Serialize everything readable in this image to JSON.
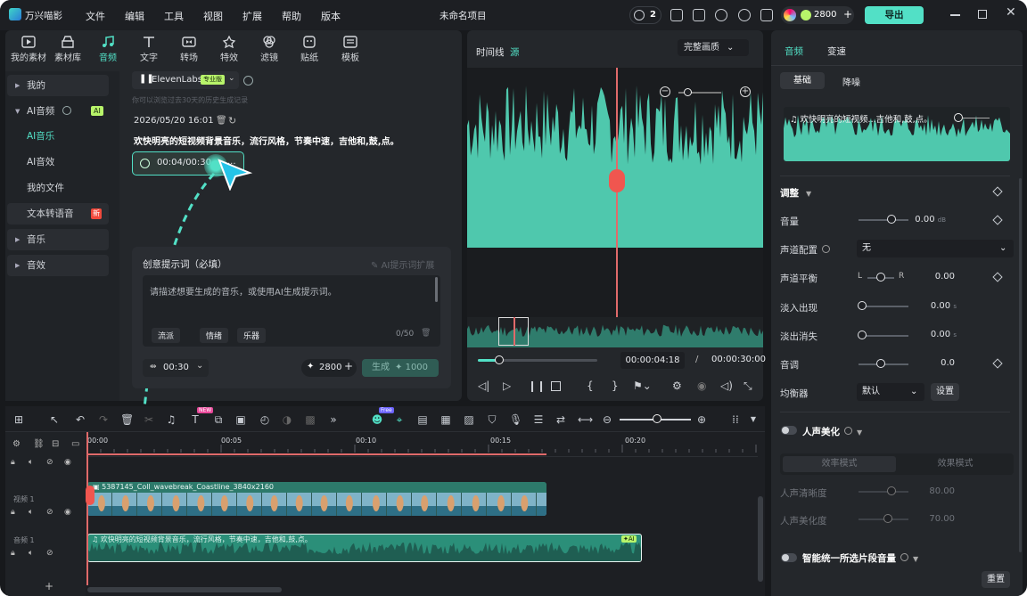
{
  "app": {
    "name": "万兴喵影",
    "project_title": "未命名项目",
    "notif_count": "2",
    "credits": "2800",
    "export_label": "导出"
  },
  "menu": [
    "文件",
    "编辑",
    "工具",
    "视图",
    "扩展",
    "帮助",
    "版本"
  ],
  "tools": [
    "我的素材",
    "素材库",
    "音频",
    "文字",
    "转场",
    "特效",
    "滤镜",
    "贴纸",
    "模板"
  ],
  "sidebar": {
    "items": [
      {
        "label": "我的"
      },
      {
        "label": "AI音频",
        "badge": "AI"
      },
      {
        "label": "AI音乐"
      },
      {
        "label": "AI音效"
      },
      {
        "label": "我的文件"
      },
      {
        "label": "文本转语音",
        "badge": "新"
      },
      {
        "label": "音乐"
      },
      {
        "label": "音效"
      }
    ]
  },
  "ai_panel": {
    "provider": "ElevenLabs",
    "provider_badge": "专业版",
    "history_hint": "你可以浏览过去30天的历史生成记录",
    "datetime": "2026/05/20 16:01",
    "prompt_text": "欢快明亮的短视频背景音乐，流行风格，节奏中速，吉他和,鼓,点。",
    "play_time": "00:04/00:30",
    "more": "...",
    "prompt_title": "创意提示词（必填）",
    "prompt_ext": "AI提示词扩展",
    "prompt_placeholder": "请描述想要生成的音乐，或使用AI生成提示词。",
    "tags": [
      "流派",
      "情绪",
      "乐器"
    ],
    "char_count": "0/50",
    "duration": "00:30",
    "cost": "2800",
    "generate_label": "生成",
    "generate_cost": "1000"
  },
  "preview": {
    "tab1": "时间线",
    "tab2": "源",
    "quality": "完整画质",
    "time_current": "00:00:04:18",
    "time_sep": "/",
    "time_total": "00:00:30:00"
  },
  "timeline": {
    "ticks": [
      "00:00",
      "00:05",
      "00:10",
      "00:15",
      "00:20"
    ],
    "video_track": "视频 1",
    "audio_track": "音频 1",
    "video_clip": "5387145_Coll_wavebreak_Coastline_3840x2160",
    "audio_clip": "欢快明亮的短视频背景音乐，流行风格，节奏中速，吉他和,鼓,点。",
    "audio_badge": "AI",
    "new_badge": "NEW",
    "free_badge": "Free"
  },
  "right": {
    "tabs": [
      "音频",
      "变速"
    ],
    "subtabs": [
      "基础",
      "降噪"
    ],
    "clip_title": "欢快明亮的短视频...吉他和,鼓,点。",
    "adjust": "调整",
    "rows": [
      {
        "label": "音量",
        "value": "0.00",
        "unit": "dB",
        "pos": 0.57
      },
      {
        "label": "声道配置",
        "select": "无"
      },
      {
        "label": "声道平衡",
        "left": "L",
        "right": "R",
        "value": "0.00",
        "pos": 0.5
      },
      {
        "label": "淡入出现",
        "value": "0.00",
        "unit": "s",
        "pos": 0
      },
      {
        "label": "淡出消失",
        "value": "0.00",
        "unit": "s",
        "pos": 0
      },
      {
        "label": "音调",
        "value": "0.0",
        "pos": 0.37
      },
      {
        "label": "均衡器",
        "select": "默认",
        "button": "设置"
      }
    ],
    "voice": "人声美化",
    "voice_modes": [
      "效率模式",
      "效果模式"
    ],
    "voice_rows": [
      {
        "label": "人声清晰度",
        "value": "80.00",
        "pos": 0.8
      },
      {
        "label": "人声美化度",
        "value": "70.00",
        "pos": 0.7
      }
    ],
    "smart": "智能统一所选片段音量",
    "reset": "重置"
  }
}
